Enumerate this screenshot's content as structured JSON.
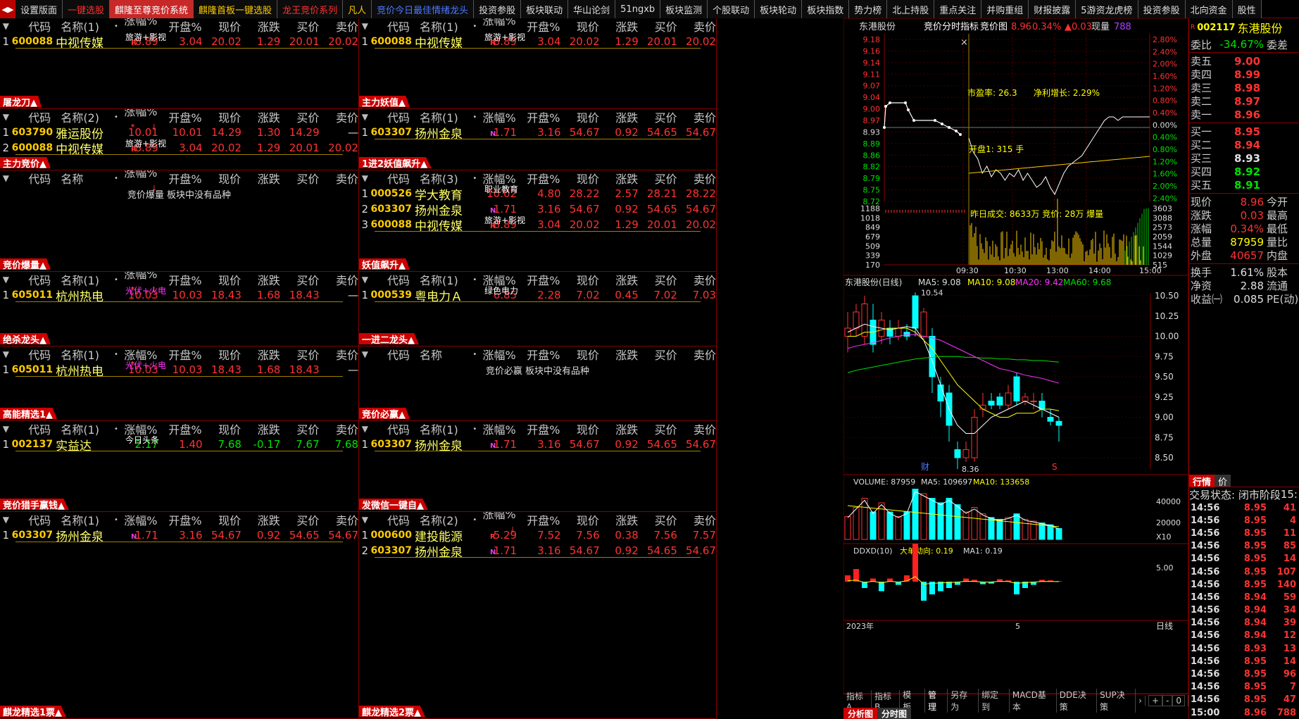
{
  "tabs": [
    "设置版面",
    "一键选股",
    "麒隆至尊竞价系统",
    "麒隆首板一键选股",
    "龙王竞价系列",
    "凡人",
    "竞价今日最佳情绪龙头",
    "投资参股",
    "板块联动",
    "华山论剑",
    "51ngxb",
    "板块监测",
    "个股联动",
    "板块轮动",
    "板块指数",
    "势力榜",
    "北上持股",
    "重点关注",
    "并购重组",
    "财报披露",
    "5游资龙虎榜",
    "投资参股",
    "北向资金",
    "股性"
  ],
  "tab_nav_icon": "arrows-icon",
  "headers": {
    "chev": "▼",
    "code": "代码",
    "dot": "•",
    "pct": "涨幅%",
    "open": "开盘%",
    "price": "现价",
    "change": "涨跌",
    "bid": "买价",
    "ask": "卖价"
  },
  "panels": {
    "p1": {
      "title": "屠龙刀▲",
      "name_header": "名称(1)",
      "pct_sort": "↓",
      "rows": [
        {
          "idx": "1",
          "code": "600088",
          "name": "中视传媒",
          "tag": "旅游+影视",
          "marker": "R",
          "pct": "8.89",
          "open": "3.04",
          "price": "20.02",
          "chg": "1.29",
          "bid": "20.01",
          "ask": "20.02"
        }
      ]
    },
    "p2": {
      "title": "主力妖值▲",
      "name_header": "名称(1)",
      "pct_sort": "↓",
      "rows": [
        {
          "idx": "1",
          "code": "600088",
          "name": "中视传媒",
          "tag": "旅游+影视",
          "marker": "R",
          "pct": "8.89",
          "open": "3.04",
          "price": "20.02",
          "chg": "1.29",
          "bid": "20.01",
          "ask": "20.02"
        }
      ]
    },
    "p3": {
      "title": "主力竞价▲",
      "name_header": "名称(2)",
      "pct_sort": "↓",
      "rows": [
        {
          "idx": "1",
          "code": "603790",
          "name": "雅运股份",
          "tag": "",
          "marker": "*",
          "pct": "10.01",
          "open": "10.01",
          "price": "14.29",
          "chg": "1.30",
          "bid": "14.29",
          "ask": "—"
        },
        {
          "idx": "2",
          "code": "600088",
          "name": "中视传媒",
          "tag": "旅游+影视",
          "marker": "R",
          "pct": "8.89",
          "open": "3.04",
          "price": "20.02",
          "chg": "1.29",
          "bid": "20.01",
          "ask": "20.02"
        }
      ]
    },
    "p4": {
      "title": "1进2妖值飙升▲",
      "name_header": "名称(1)",
      "pct_sort": "",
      "rows": [
        {
          "idx": "1",
          "code": "603307",
          "name": "扬州金泉",
          "tag": "",
          "marker": "N",
          "pct": "1.71",
          "open": "3.16",
          "price": "54.67",
          "chg": "0.92",
          "bid": "54.65",
          "ask": "54.67"
        }
      ]
    },
    "p5": {
      "title": "竞价爆量▲",
      "name_header": "名称",
      "pct_sort": "↓",
      "empty": "竞价爆量 板块中没有品种",
      "rows": []
    },
    "p6": {
      "title": "妖值飙升▲",
      "name_header": "名称(3)",
      "pct_sort": "",
      "rows": [
        {
          "idx": "1",
          "code": "000526",
          "name": "学大教育",
          "tag": "职业教育",
          "marker": "",
          "pct": "10.02",
          "open": "4.80",
          "price": "28.22",
          "chg": "2.57",
          "bid": "28.21",
          "ask": "28.22"
        },
        {
          "idx": "2",
          "code": "603307",
          "name": "扬州金泉",
          "tag": "",
          "marker": "N",
          "pct": "1.71",
          "open": "3.16",
          "price": "54.67",
          "chg": "0.92",
          "bid": "54.65",
          "ask": "54.67"
        },
        {
          "idx": "3",
          "code": "600088",
          "name": "中视传媒",
          "tag": "旅游+影视",
          "marker": "R",
          "pct": "8.89",
          "open": "3.04",
          "price": "20.02",
          "chg": "1.29",
          "bid": "20.01",
          "ask": "20.02"
        }
      ]
    },
    "p7": {
      "title": "绝杀龙头▲",
      "name_header": "名称(1)",
      "pct_sort": "↓",
      "rows": [
        {
          "idx": "1",
          "code": "605011",
          "name": "杭州热电",
          "tag": "光伏+火电",
          "marker": "*",
          "pct": "10.03",
          "open": "10.03",
          "price": "18.43",
          "chg": "1.68",
          "bid": "18.43",
          "ask": "—"
        }
      ]
    },
    "p8": {
      "title": "一进二龙头▲",
      "name_header": "名称(1)",
      "pct_sort": "",
      "rows": [
        {
          "idx": "1",
          "code": "000539",
          "name": "粤电力Ａ",
          "tag": "绿色电力",
          "marker": "",
          "pct": "6.85",
          "open": "2.28",
          "price": "7.02",
          "chg": "0.45",
          "bid": "7.02",
          "ask": "7.03"
        }
      ]
    },
    "p9": {
      "title": "高能精选1▲",
      "name_header": "名称(1)",
      "pct_sort": "",
      "rows": [
        {
          "idx": "1",
          "code": "605011",
          "name": "杭州热电",
          "tag": "光伏+火电",
          "marker": "*",
          "pct": "10.03",
          "open": "10.03",
          "price": "18.43",
          "chg": "1.68",
          "bid": "18.43",
          "ask": "—"
        }
      ]
    },
    "p10": {
      "title": "竞价必赢▲",
      "name_header": "名称",
      "pct_sort": "",
      "empty": "竞价必赢 板块中没有品种",
      "rows": []
    },
    "p11": {
      "title": "竞价猎手赢钱▲",
      "name_header": "名称(1)",
      "pct_sort": "",
      "rows": [
        {
          "idx": "1",
          "code": "002137",
          "name": "实益达",
          "tag": "今日头条",
          "marker": "",
          "pct": "2.17",
          "open": "1.40",
          "price": "7.68",
          "chg": "-0.17",
          "bid": "7.67",
          "ask": "7.68"
        }
      ]
    },
    "p12": {
      "title": "发微信一键自▲",
      "name_header": "名称(1)",
      "pct_sort": "",
      "rows": [
        {
          "idx": "1",
          "code": "603307",
          "name": "扬州金泉",
          "tag": "",
          "marker": "N",
          "pct": "1.71",
          "open": "3.16",
          "price": "54.67",
          "chg": "0.92",
          "bid": "54.65",
          "ask": "54.67"
        }
      ]
    },
    "p13": {
      "title": "麒龙精选1票▲",
      "name_header": "名称(1)",
      "pct_sort": "",
      "rows": [
        {
          "idx": "1",
          "code": "603307",
          "name": "扬州金泉",
          "tag": "",
          "marker": "N",
          "pct": "1.71",
          "open": "3.16",
          "price": "54.67",
          "chg": "0.92",
          "bid": "54.65",
          "ask": "54.67"
        }
      ]
    },
    "p14": {
      "title": "麒龙精选2票▲",
      "name_header": "名称(2)",
      "pct_sort": "↓",
      "rows": [
        {
          "idx": "1",
          "code": "000600",
          "name": "建投能源",
          "tag": "",
          "marker": "R",
          "pct": "5.29",
          "open": "7.52",
          "price": "7.56",
          "chg": "0.38",
          "bid": "7.56",
          "ask": "7.57"
        },
        {
          "idx": "2",
          "code": "603307",
          "name": "扬州金泉",
          "tag": "",
          "marker": "N",
          "pct": "1.71",
          "open": "3.16",
          "price": "54.67",
          "chg": "0.92",
          "bid": "54.65",
          "ask": "54.67"
        }
      ]
    }
  },
  "intraday": {
    "header": "东港股份",
    "indicator": "竞价分时指标",
    "auction_label": "竞价图",
    "price": "8.96",
    "pct": "0.34%",
    "chg": "▲0.03",
    "volume_label": "现量",
    "volume": "788",
    "close_glyph": "×",
    "pe_text": "市盈率: 26.3",
    "growth_text": "净利增长: 2.29%",
    "open_text": "开盘1: 315 手",
    "auction_text": "昨日成交: 8633万  竞价: 28万  爆量",
    "price_labels": [
      "9.18",
      "9.16",
      "9.14",
      "9.11",
      "9.07",
      "9.04",
      "9.00",
      "8.97",
      "8.93",
      "8.89",
      "8.86",
      "8.82",
      "8.79",
      "8.75",
      "8.72"
    ],
    "pct_labels": [
      "2.80%",
      "2.40%",
      "2.00%",
      "1.60%",
      "1.20%",
      "0.80%",
      "0.40%",
      "0.00%",
      "0.40%",
      "0.80%",
      "1.20%",
      "1.60%",
      "2.00%",
      "2.40%"
    ],
    "vol_labels": [
      "1188",
      "1018",
      "849",
      "679",
      "509",
      "339",
      "170"
    ],
    "vol_right_labels": [
      "3603",
      "3088",
      "2573",
      "2059",
      "1544",
      "1029",
      "515"
    ],
    "time_labels": [
      "09:30",
      "10:30",
      "13:00",
      "14:00",
      "15:00"
    ],
    "prev_close": 8.93
  },
  "daily": {
    "title": "东港股份(日线)",
    "ma5": "MA5: 9.08",
    "ma10": "MA10: 9.08",
    "ma20": "MA20: 9.42",
    "ma60": "MA60: 9.68",
    "hi_label": "10.54",
    "lo_label": "8.36",
    "price_labels": [
      "10.50",
      "10.25",
      "10.00",
      "9.75",
      "9.50",
      "9.25",
      "9.00",
      "8.75",
      "8.50"
    ],
    "cai_label": "财",
    "s_label": "S",
    "volume_title": "VOLUME: 87959",
    "vol_ma5": "MA5: 109697",
    "vol_ma10": "MA10: 133658",
    "vol_labels": [
      "40000",
      "20000"
    ],
    "vol_unit": "X10",
    "ddx_title": "DDXD(10)",
    "ddx_big": "大单动向: 0.19",
    "ddx_ma1": "MA1: 0.19",
    "ddx_label": "5.00",
    "year_label": "2023年",
    "month_label": "5",
    "period_label": "日线"
  },
  "quote": {
    "code": "002117",
    "name": "东港股份",
    "weibi_label": "委比",
    "weibi": "-34.67%",
    "weicha_label": "委差",
    "sells": [
      {
        "label": "卖五",
        "price": "9.00"
      },
      {
        "label": "卖四",
        "price": "8.99"
      },
      {
        "label": "卖三",
        "price": "8.98"
      },
      {
        "label": "卖二",
        "price": "8.97"
      },
      {
        "label": "卖一",
        "price": "8.96"
      }
    ],
    "buys": [
      {
        "label": "买一",
        "price": "8.95"
      },
      {
        "label": "买二",
        "price": "8.94"
      },
      {
        "label": "买三",
        "price": "8.93"
      },
      {
        "label": "买四",
        "price": "8.92"
      },
      {
        "label": "买五",
        "price": "8.91"
      }
    ],
    "stats": [
      {
        "label": "现价",
        "value": "8.96",
        "label2": "今开"
      },
      {
        "label": "涨跌",
        "value": "0.03",
        "label2": "最高"
      },
      {
        "label": "涨幅",
        "value": "0.34%",
        "label2": "最低"
      },
      {
        "label": "总量",
        "value": "87959",
        "label2": "量比"
      },
      {
        "label": "外盘",
        "value": "40657",
        "label2": "内盘"
      }
    ],
    "stats2": [
      {
        "label": "换手",
        "value": "1.61%",
        "label2": "股本"
      },
      {
        "label": "净资",
        "value": "2.88",
        "label2": "流通"
      },
      {
        "label": "收益㈠",
        "value": "0.085",
        "label2": "PE(动)"
      }
    ],
    "tab_quote": "行情",
    "tab_price": "价",
    "status_label": "交易状态: 闭市阶段",
    "status_time": "15:",
    "ticks": [
      {
        "t": "14:56",
        "p": "8.95",
        "v": "41"
      },
      {
        "t": "14:56",
        "p": "8.95",
        "v": "4"
      },
      {
        "t": "14:56",
        "p": "8.95",
        "v": "11"
      },
      {
        "t": "14:56",
        "p": "8.95",
        "v": "85"
      },
      {
        "t": "14:56",
        "p": "8.95",
        "v": "14"
      },
      {
        "t": "14:56",
        "p": "8.95",
        "v": "107"
      },
      {
        "t": "14:56",
        "p": "8.95",
        "v": "140"
      },
      {
        "t": "14:56",
        "p": "8.94",
        "v": "59"
      },
      {
        "t": "14:56",
        "p": "8.94",
        "v": "34"
      },
      {
        "t": "14:56",
        "p": "8.94",
        "v": "39"
      },
      {
        "t": "14:56",
        "p": "8.94",
        "v": "12"
      },
      {
        "t": "14:56",
        "p": "8.93",
        "v": "13"
      },
      {
        "t": "14:56",
        "p": "8.95",
        "v": "14"
      },
      {
        "t": "14:56",
        "p": "8.95",
        "v": "96"
      },
      {
        "t": "14:56",
        "p": "8.95",
        "v": "7"
      },
      {
        "t": "14:56",
        "p": "8.95",
        "v": "47"
      },
      {
        "t": "15:00",
        "p": "8.96",
        "v": "788"
      }
    ]
  },
  "bottom": {
    "tabs1": [
      "指标A",
      "指标B",
      "模 板",
      "管理",
      "另存为",
      "绑定到",
      "MACD基本",
      "DDE决策",
      "SUP决策",
      "›"
    ],
    "controls": [
      "+",
      "-",
      "0"
    ],
    "tabs2": [
      "分析图",
      "分时图"
    ]
  }
}
